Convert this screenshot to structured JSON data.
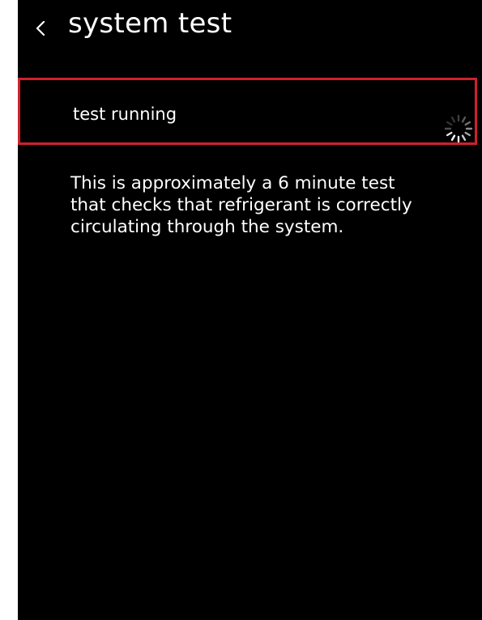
{
  "header": {
    "title": "system test",
    "back_icon": "chevron-left-icon"
  },
  "status": {
    "label": "test running",
    "indicator_icon": "loading-spinner-icon",
    "highlight_color": "#d0202e"
  },
  "description": {
    "lines": [
      "This is approximately a 6 minute test",
      "that checks that refrigerant is correctly",
      "circulating through the system."
    ]
  },
  "colors": {
    "background": "#000000",
    "text": "#ffffff",
    "accent": "#d0202e"
  }
}
